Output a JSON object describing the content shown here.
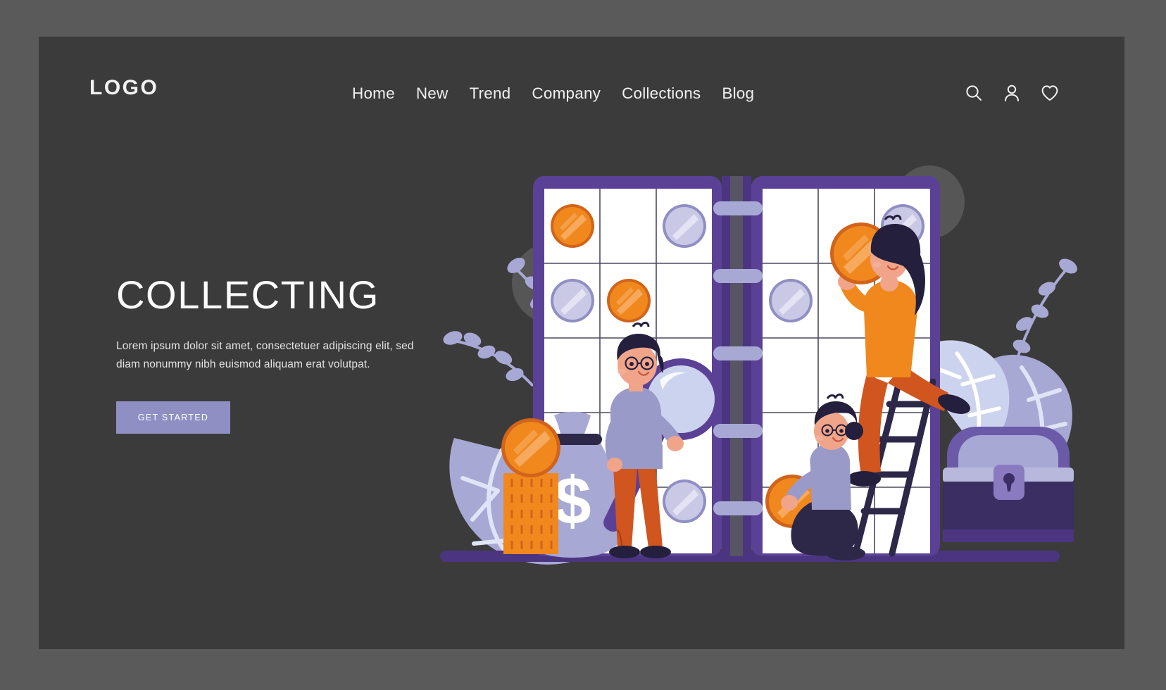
{
  "page": {
    "background_color": "#5a5a5a",
    "card_color": "#3b3b3b"
  },
  "header": {
    "logo": "LOGO",
    "nav": [
      {
        "label": "Home"
      },
      {
        "label": "New"
      },
      {
        "label": "Trend"
      },
      {
        "label": "Company"
      },
      {
        "label": "Collections"
      },
      {
        "label": "Blog"
      }
    ],
    "icons": [
      {
        "name": "search-icon"
      },
      {
        "name": "user-icon"
      },
      {
        "name": "heart-icon"
      }
    ]
  },
  "hero": {
    "headline": "COLLECTING",
    "subtext": "Lorem ipsum dolor sit amet, consectetuer adipiscing elit, sed diam nonummy nibh euismod aliquam erat volutpat.",
    "cta_label": "GET STARTED",
    "cta_color": "#8f8fc4"
  },
  "illustration": {
    "name": "coin-collecting-illustration",
    "colors": {
      "album_frame": "#5b4196",
      "album_spine": "#4b3580",
      "page_white": "#ffffff",
      "coin_orange": "#f0881e",
      "coin_orange_dark": "#d1641a",
      "coin_silver": "#a8a8d4",
      "coin_silver_light": "#c9c9e6",
      "leaf_light": "#ccd3ee",
      "leaf_mid": "#a8a8d4",
      "skin": "#f0a58a",
      "hair_dark": "#241f3d",
      "pants_orange": "#d1551e",
      "shirt_lilac": "#9a9ac8",
      "blob_gray": "#585858",
      "base_bar": "#4b3580"
    },
    "elements": [
      "background-blob",
      "background-circle-large",
      "background-circle-small",
      "leaves-left",
      "leaves-right",
      "coin-album-left-page",
      "coin-album-right-page",
      "album-spine-rings",
      "money-bag",
      "coin-stack",
      "treasure-chest",
      "character-with-magnifier",
      "character-on-ladder",
      "character-kneeling",
      "ladder",
      "magnifying-glass"
    ]
  }
}
